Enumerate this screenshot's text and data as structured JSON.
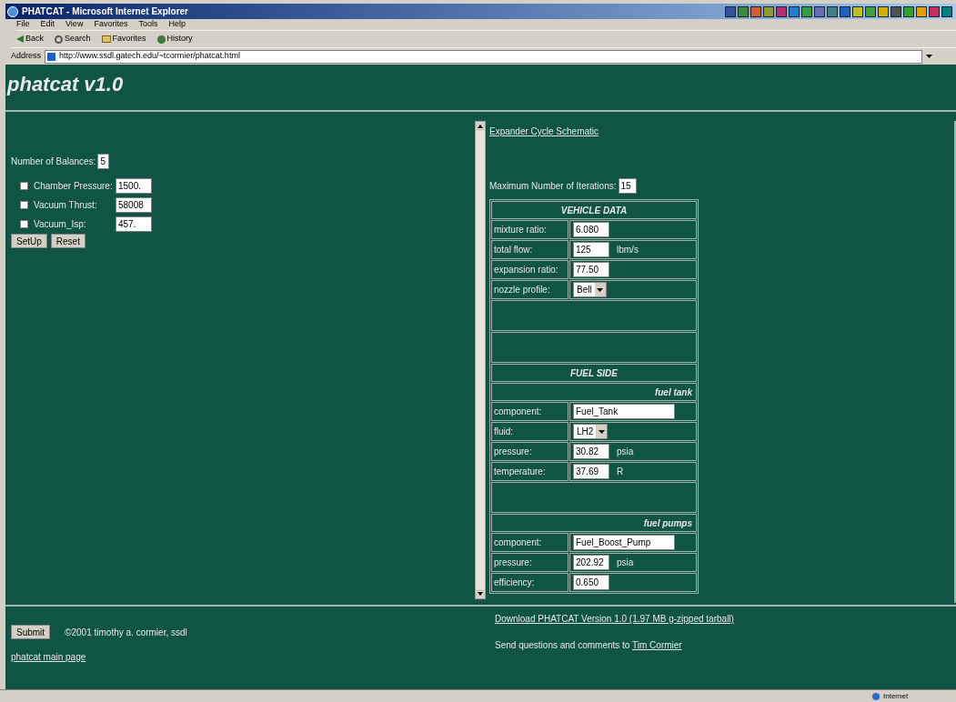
{
  "browser": {
    "title": "PHATCAT - Microsoft Internet Explorer",
    "menu": [
      "File",
      "Edit",
      "View",
      "Favorites",
      "Tools",
      "Help"
    ],
    "toolbar": [
      {
        "kind": "back",
        "label": "Back"
      },
      {
        "kind": "search",
        "label": "Search"
      },
      {
        "kind": "favorites",
        "label": "Favorites"
      },
      {
        "kind": "history",
        "label": "History"
      }
    ],
    "address_label": "Address",
    "url": "http://www.ssdl.gatech.edu/~tcormier/phatcat.html",
    "status": "Internet"
  },
  "page": {
    "heading": "phatcat v1.0",
    "left": {
      "balances_label": "Number of Balances:",
      "balances_value": "5",
      "params": [
        {
          "label": "Chamber Pressure:",
          "value": "1500.",
          "checked": false
        },
        {
          "label": "Vacuum Thrust:",
          "value": "58008",
          "checked": false
        },
        {
          "label": "Vacuum_Isp:",
          "value": "457.",
          "checked": false
        }
      ],
      "buttons": [
        "SetUp",
        "Reset"
      ]
    },
    "right": {
      "link": "Expander Cycle Schematic",
      "iterations_label": "Maximum Number of Iterations:",
      "iterations_value": "15",
      "rows": [
        {
          "kind": "heading",
          "text": "VEHICLE DATA"
        },
        {
          "kind": "input",
          "label": "mixture ratio:",
          "value": "6.080"
        },
        {
          "kind": "input",
          "label": "total flow:",
          "value": "125",
          "unit": "lbm/s"
        },
        {
          "kind": "input",
          "label": "expansion ratio:",
          "value": "77.50"
        },
        {
          "kind": "select",
          "label": "nozzle profile:",
          "value": "Bell"
        },
        {
          "kind": "blank"
        },
        {
          "kind": "blank"
        },
        {
          "kind": "heading",
          "text": "FUEL SIDE"
        },
        {
          "kind": "subheading",
          "text": "fuel tank"
        },
        {
          "kind": "wide",
          "label": "component:",
          "value": "Fuel_Tank"
        },
        {
          "kind": "select",
          "label": "fluid:",
          "value": "LH2"
        },
        {
          "kind": "input",
          "label": "pressure:",
          "value": "30.82",
          "unit": "psia"
        },
        {
          "kind": "input",
          "label": "temperature:",
          "value": "37.69",
          "unit": "R"
        },
        {
          "kind": "blank"
        },
        {
          "kind": "subheading",
          "text": "fuel pumps"
        },
        {
          "kind": "wide",
          "label": "component:",
          "value": "Fuel_Boost_Pump"
        },
        {
          "kind": "input",
          "label": "pressure:",
          "value": "202.92",
          "unit": "psia"
        },
        {
          "kind": "input",
          "label": "efficiency:",
          "value": "0.650"
        }
      ]
    },
    "footer": {
      "submit": "Submit",
      "copyright": "©2001 timothy a. cormier, ssdl",
      "main_link": "phatcat main page",
      "download_link": "Download PHATCAT Version 1.0 (1.97 MB g-zipped tarball)",
      "contact_text": "Send questions and comments to",
      "contact_link": "Tim Cormier"
    }
  }
}
